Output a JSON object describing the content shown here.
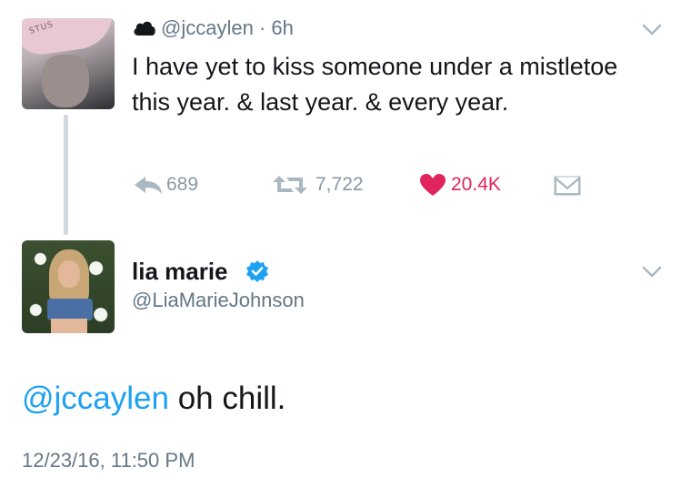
{
  "tweet1": {
    "avatar_text": "STUS",
    "handle": "@jccaylen",
    "time": "6h",
    "separator": "·",
    "text": "I have yet to kiss someone under a mistletoe this year.  & last year.  & every year.",
    "reply_count": "689",
    "retweet_count": "7,722",
    "like_count": "20.4K"
  },
  "tweet2": {
    "name": "lia marie",
    "handle": "@LiaMarieJohnson",
    "mention": "@jccaylen",
    "text": " oh chill.",
    "timestamp": "12/23/16, 11:50 PM"
  },
  "icons": {
    "cloud": "cloud-icon",
    "chevron": "chevron-down-icon",
    "reply": "reply-icon",
    "retweet": "retweet-icon",
    "like": "heart-icon",
    "dm": "direct-message-icon",
    "verified": "verified-badge-icon"
  },
  "colors": {
    "link": "#1da1f2",
    "like": "#e0245e",
    "muted": "#657786",
    "action": "#8899a6",
    "text": "#14171a"
  }
}
